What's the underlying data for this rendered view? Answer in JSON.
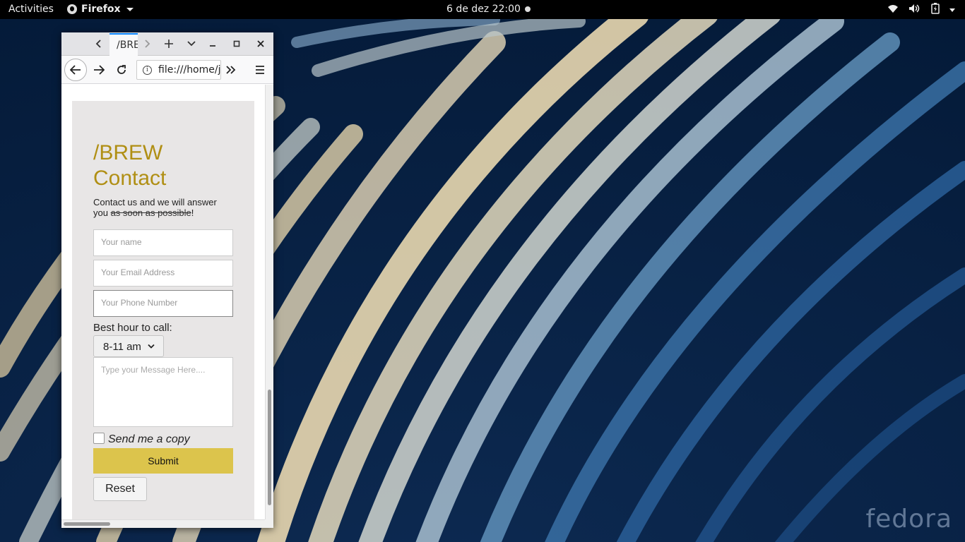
{
  "topbar": {
    "activities": "Activities",
    "app_name": "Firefox",
    "clock": "6 de dez  22:00"
  },
  "browser": {
    "tab_title": "/BREW",
    "url": "file:///home/j"
  },
  "page": {
    "title_line1": "/BREW",
    "title_line2": "Contact",
    "intro_prefix": "Contact us and we will answer you ",
    "intro_struck": "as soon as possible",
    "intro_suffix": "!",
    "name_placeholder": "Your name",
    "email_placeholder": "Your Email Address",
    "phone_placeholder": "Your Phone Number",
    "best_hour_label": "Best hour to call:",
    "best_hour_selected": "8-11 am",
    "message_placeholder": "Type your Message Here....",
    "copy_label": "Send me a copy",
    "submit_label": "Submit",
    "reset_label": "Reset"
  },
  "desktop": {
    "logo_text": "fedora"
  },
  "colors": {
    "title": "#b08f14",
    "submit_bg": "#dcc44c",
    "card_bg": "#e8e6e6"
  }
}
